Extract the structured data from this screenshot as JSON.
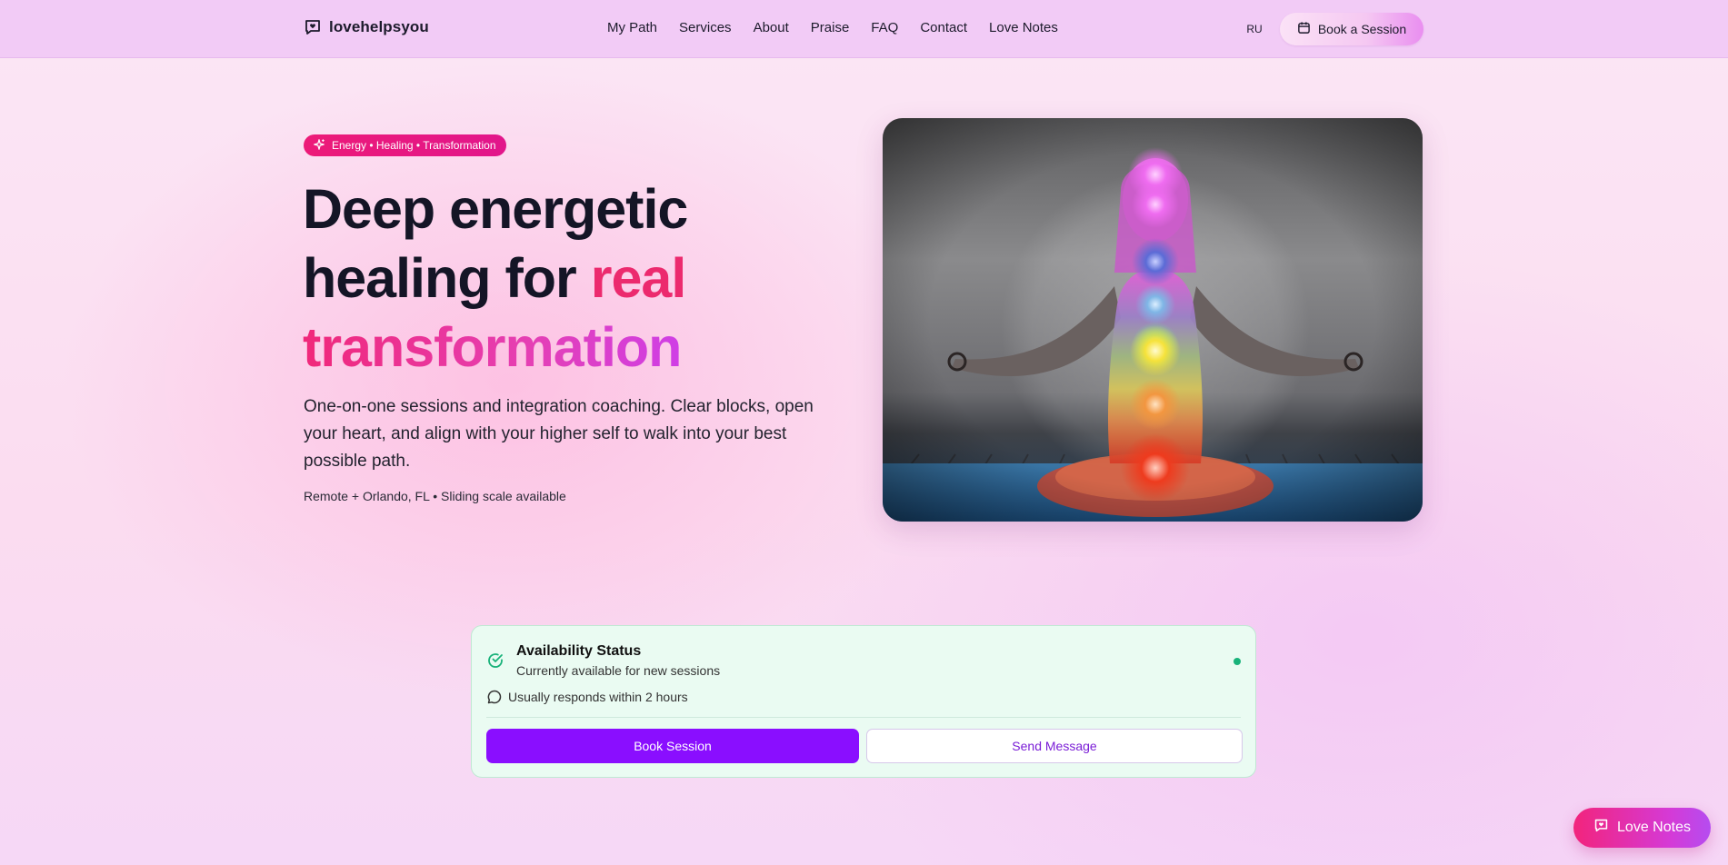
{
  "brand": {
    "name": "lovehelpsyou",
    "icon": "heart-message-icon"
  },
  "nav": [
    {
      "label": "My Path"
    },
    {
      "label": "Services"
    },
    {
      "label": "About"
    },
    {
      "label": "Praise"
    },
    {
      "label": "FAQ"
    },
    {
      "label": "Contact"
    },
    {
      "label": "Love Notes"
    }
  ],
  "header": {
    "lang": "RU",
    "book_label": "Book a Session",
    "book_icon": "calendar-icon"
  },
  "hero": {
    "badge": "Energy • Healing • Transformation",
    "badge_icon": "sparkles-icon",
    "headline_1": "Deep energetic",
    "headline_2": "healing for ",
    "headline_accent_1": "real",
    "headline_accent_2": "transformation",
    "lede": "One-on-one sessions and integration coaching. Clear blocks, open your heart, and align with your higher self to walk into your best possible path.",
    "meta": "Remote + Orlando, FL • Sliding scale available",
    "image": "meditation-chakra-image"
  },
  "availability": {
    "title": "Availability Status",
    "subtitle": "Currently available for new sessions",
    "response": "Usually responds within 2 hours",
    "book": "Book Session",
    "message": "Send Message",
    "status_color": "#19b27a"
  },
  "floating": {
    "label": "Love Notes"
  },
  "colors": {
    "accent_pink": "#ec1a78",
    "accent_purple": "#8a0eff",
    "header_bg": "#f2cbf6",
    "card_bg": "#eafbf2"
  }
}
